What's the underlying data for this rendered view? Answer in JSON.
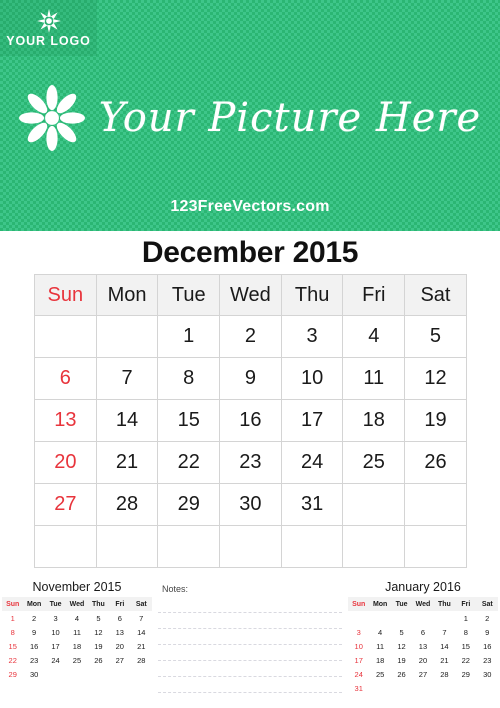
{
  "header": {
    "logo_text": "YOUR LOGO",
    "logo_icon": "flower-burst-icon",
    "picture_title": "Your Picture Here",
    "picture_icon": "flower-icon",
    "watermark": "123FreeVectors.com",
    "background_color": "#2bb673",
    "background_accent_color": "#3ec68a"
  },
  "calendar": {
    "title": "December 2015",
    "sunday_color": "#e8343c",
    "header_bg": "#f2f2f2",
    "weekdays": [
      "Sun",
      "Mon",
      "Tue",
      "Wed",
      "Thu",
      "Fri",
      "Sat"
    ],
    "weeks": [
      [
        "",
        "",
        "1",
        "2",
        "3",
        "4",
        "5"
      ],
      [
        "6",
        "7",
        "8",
        "9",
        "10",
        "11",
        "12"
      ],
      [
        "13",
        "14",
        "15",
        "16",
        "17",
        "18",
        "19"
      ],
      [
        "20",
        "21",
        "22",
        "23",
        "24",
        "25",
        "26"
      ],
      [
        "27",
        "28",
        "29",
        "30",
        "31",
        "",
        ""
      ],
      [
        "",
        "",
        "",
        "",
        "",
        "",
        ""
      ]
    ]
  },
  "prev_month": {
    "title": "November 2015",
    "weekdays": [
      "Sun",
      "Mon",
      "Tue",
      "Wed",
      "Thu",
      "Fri",
      "Sat"
    ],
    "weeks": [
      [
        "1",
        "2",
        "3",
        "4",
        "5",
        "6",
        "7"
      ],
      [
        "8",
        "9",
        "10",
        "11",
        "12",
        "13",
        "14"
      ],
      [
        "15",
        "16",
        "17",
        "18",
        "19",
        "20",
        "21"
      ],
      [
        "22",
        "23",
        "24",
        "25",
        "26",
        "27",
        "28"
      ],
      [
        "29",
        "30",
        "",
        "",
        "",
        "",
        ""
      ]
    ]
  },
  "next_month": {
    "title": "January 2016",
    "weekdays": [
      "Sun",
      "Mon",
      "Tue",
      "Wed",
      "Thu",
      "Fri",
      "Sat"
    ],
    "weeks": [
      [
        "",
        "",
        "",
        "",
        "",
        "1",
        "2"
      ],
      [
        "3",
        "4",
        "5",
        "6",
        "7",
        "8",
        "9"
      ],
      [
        "10",
        "11",
        "12",
        "13",
        "14",
        "15",
        "16"
      ],
      [
        "17",
        "18",
        "19",
        "20",
        "21",
        "22",
        "23"
      ],
      [
        "24",
        "25",
        "26",
        "27",
        "28",
        "29",
        "30"
      ],
      [
        "31",
        "",
        "",
        "",
        "",
        "",
        ""
      ]
    ]
  },
  "notes": {
    "label": "Notes:",
    "line_count": 6
  }
}
